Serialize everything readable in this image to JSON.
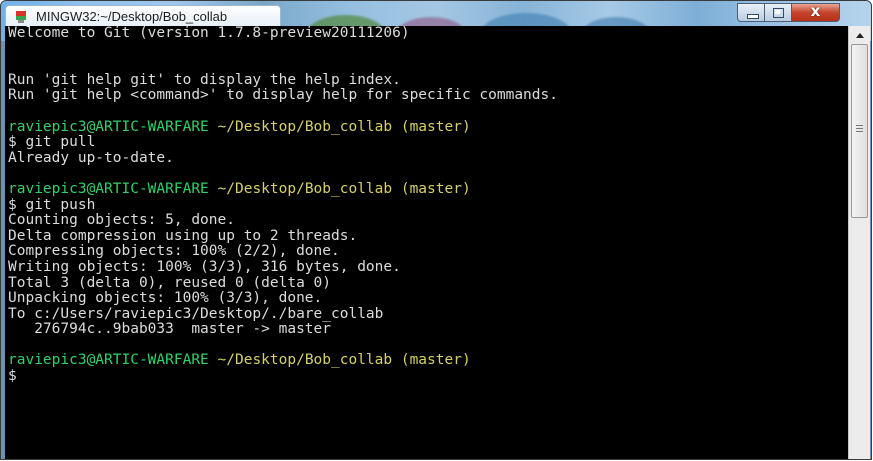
{
  "window": {
    "title": "MINGW32:~/Desktop/Bob_collab",
    "controls": {
      "minimize_icon": "minimize-icon",
      "maximize_icon": "maximize-icon",
      "close_icon": "close-icon",
      "close_glyph": "x"
    },
    "app_icon": "git-bash-icon"
  },
  "terminal": {
    "colors": {
      "background": "#000000",
      "text": "#dcdcdc",
      "user": "#2fd06a",
      "path": "#d6cf6a"
    },
    "lines": [
      {
        "text": "Welcome to Git (version 1.7.8-preview20111206)"
      },
      {
        "text": ""
      },
      {
        "text": ""
      },
      {
        "text": "Run 'git help git' to display the help index."
      },
      {
        "text": "Run 'git help <command>' to display help for specific commands."
      },
      {
        "text": ""
      },
      {
        "prompt": {
          "user": "raviepic3@ARTIC-WARFARE",
          "path": " ~/Desktop/Bob_collab (master)"
        }
      },
      {
        "text": "$ git pull"
      },
      {
        "text": "Already up-to-date."
      },
      {
        "text": ""
      },
      {
        "prompt": {
          "user": "raviepic3@ARTIC-WARFARE",
          "path": " ~/Desktop/Bob_collab (master)"
        }
      },
      {
        "text": "$ git push"
      },
      {
        "text": "Counting objects: 5, done."
      },
      {
        "text": "Delta compression using up to 2 threads."
      },
      {
        "text": "Compressing objects: 100% (2/2), done."
      },
      {
        "text": "Writing objects: 100% (3/3), 316 bytes, done."
      },
      {
        "text": "Total 3 (delta 0), reused 0 (delta 0)"
      },
      {
        "text": "Unpacking objects: 100% (3/3), done."
      },
      {
        "text": "To c:/Users/raviepic3/Desktop/./bare_collab"
      },
      {
        "text": "   276794c..9bab033  master -> master"
      },
      {
        "text": ""
      },
      {
        "prompt": {
          "user": "raviepic3@ARTIC-WARFARE",
          "path": " ~/Desktop/Bob_collab (master)"
        }
      },
      {
        "text": "$"
      }
    ]
  },
  "scrollbar": {
    "up_arrow_icon": "scroll-up-arrow-icon",
    "grip_icon": "scroll-grip-icon"
  }
}
